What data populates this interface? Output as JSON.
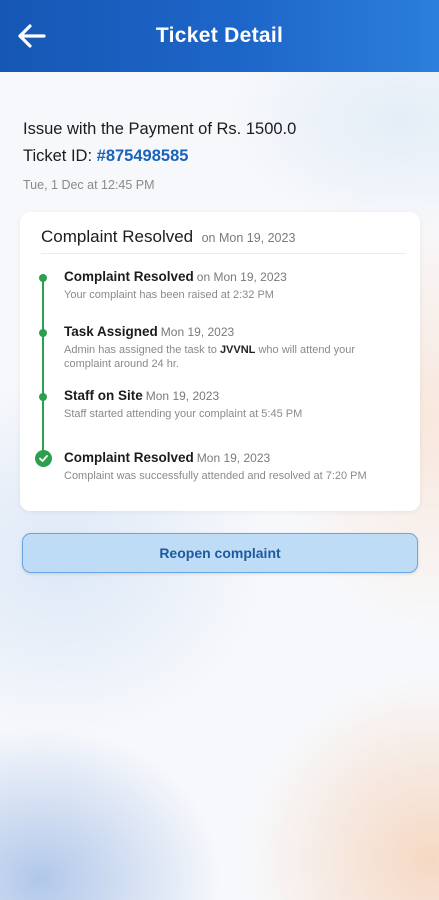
{
  "header": {
    "title": "Ticket Detail",
    "back_icon": "arrow-left-icon"
  },
  "ticket": {
    "issue_title": "Issue with the Payment of Rs. 1500.0",
    "id_label": "Ticket ID:",
    "id_value": "#875498585",
    "date": "Tue, 1 Dec at 12:45 PM"
  },
  "status_card": {
    "status": "Complaint Resolved",
    "on_date": "on Mon 19, 2023",
    "steps": [
      {
        "title": "Complaint Resolved",
        "date": "on Mon 19, 2023",
        "desc": "Your complaint has been raised at 2:32 PM",
        "marker": "dot"
      },
      {
        "title": "Task Assigned",
        "date": "Mon 19, 2023",
        "desc_before": "Admin has assigned the task to ",
        "desc_bold": "JVVNL",
        "desc_after": " who will attend your complaint around 24 hr.",
        "marker": "dot"
      },
      {
        "title": "Staff on Site",
        "date": "Mon 19, 2023",
        "desc": "Staff started attending your complaint at 5:45 PM",
        "marker": "dot"
      },
      {
        "title": "Complaint Resolved",
        "date": "Mon 19, 2023",
        "desc": "Complaint was successfully attended and resolved at 7:20 PM",
        "marker": "check"
      }
    ]
  },
  "actions": {
    "reopen_label": "Reopen complaint"
  },
  "colors": {
    "header": "#1d66c9",
    "accent": "#1a63b8",
    "success": "#2e9e4f",
    "button_bg": "#bfdcf6"
  }
}
